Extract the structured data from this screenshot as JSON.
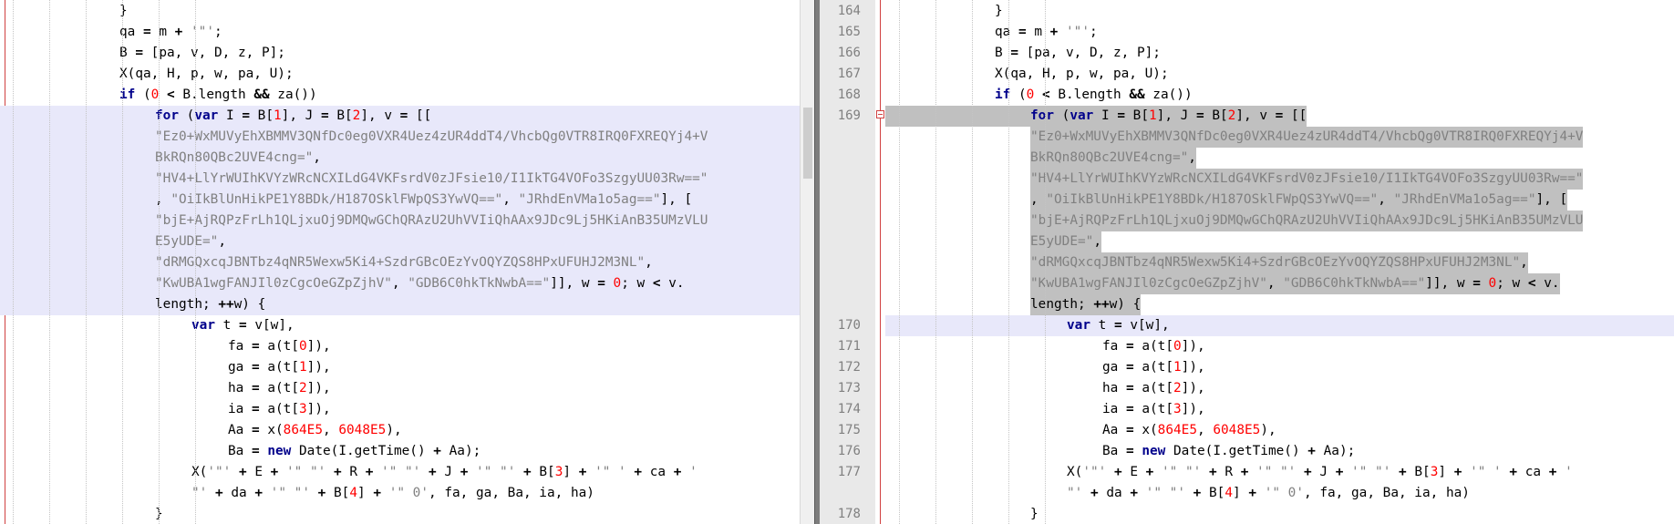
{
  "left": {
    "lines": [
      [
        {
          "t": "}"
        }
      ],
      [
        {
          "t": "qa "
        },
        {
          "t": "=",
          "c": "op"
        },
        {
          "t": " m "
        },
        {
          "t": "+",
          "c": "op"
        },
        {
          "t": " '\"'",
          "c": "str"
        },
        {
          "t": ";"
        }
      ],
      [
        {
          "t": "B "
        },
        {
          "t": "=",
          "c": "op"
        },
        {
          "t": " [pa, v, D, z, P];"
        }
      ],
      [
        {
          "t": "X(qa, H, p, w, pa, U);"
        }
      ],
      [
        {
          "t": "if",
          "c": "kw"
        },
        {
          "t": " ("
        },
        {
          "t": "0",
          "c": "num"
        },
        {
          "t": " "
        },
        {
          "t": "<",
          "c": "op"
        },
        {
          "t": " B.length "
        },
        {
          "t": "&&",
          "c": "op"
        },
        {
          "t": " za())"
        }
      ],
      [
        {
          "t": "for",
          "c": "kw"
        },
        {
          "t": " ("
        },
        {
          "t": "var",
          "c": "kw"
        },
        {
          "t": " I "
        },
        {
          "t": "=",
          "c": "op"
        },
        {
          "t": " B["
        },
        {
          "t": "1",
          "c": "num"
        },
        {
          "t": "], J "
        },
        {
          "t": "=",
          "c": "op"
        },
        {
          "t": " B["
        },
        {
          "t": "2",
          "c": "num"
        },
        {
          "t": "], v "
        },
        {
          "t": "=",
          "c": "op"
        },
        {
          "t": " [["
        }
      ],
      [
        {
          "t": "\"Ez0+WxMUVyEhXBMMV3QNfDc0eg0VXR4Uez4zUR4ddT4/VhcbQg0VTR8IRQ0FXREQYj4+V",
          "c": "str"
        }
      ],
      [
        {
          "t": "BkRQn80QBc2UVE4cng=\"",
          "c": "str"
        },
        {
          "t": ","
        }
      ],
      [
        {
          "t": "\"HV4+LlYrWUIhKVYzWRcNCXILdG4VKFsrdV0zJFsie10/I1IkTG4VOFo3SzgyUU03Rw==\"",
          "c": "str"
        }
      ],
      [
        {
          "t": ", "
        },
        {
          "t": "\"OiIkBlUnHikPE1Y8BDk/H187OSklFWpQS3YwVQ==\"",
          "c": "str"
        },
        {
          "t": ", "
        },
        {
          "t": "\"JRhdEnVMa1o5ag==\"",
          "c": "str"
        },
        {
          "t": "], ["
        }
      ],
      [
        {
          "t": "\"bjE+AjRQPzFrLh1QLjxuOj9DMQwGChQRAzU2UhVVIiQhAAx9JDc9Lj5HKiAnB35UMzVLU",
          "c": "str"
        }
      ],
      [
        {
          "t": "E5yUDE=\"",
          "c": "str"
        },
        {
          "t": ","
        }
      ],
      [
        {
          "t": "\"dRMGQxcqJBNTbz4qNR5Wexw5Ki4+SzdrGBcOEzYvOQYZQS8HPxUFUHJ2M3NL\"",
          "c": "str"
        },
        {
          "t": ","
        }
      ],
      [
        {
          "t": "\"KwUBA1wgFANJIl0zCgcOeGZpZjhV\"",
          "c": "str"
        },
        {
          "t": ", "
        },
        {
          "t": "\"GDB6C0hkTkNwbA==\"",
          "c": "str"
        },
        {
          "t": "]], w "
        },
        {
          "t": "=",
          "c": "op"
        },
        {
          "t": " "
        },
        {
          "t": "0",
          "c": "num"
        },
        {
          "t": "; w "
        },
        {
          "t": "<",
          "c": "op"
        },
        {
          "t": " v."
        }
      ],
      [
        {
          "t": "length; "
        },
        {
          "t": "++",
          "c": "op"
        },
        {
          "t": "w) {"
        }
      ],
      [
        {
          "t": "var",
          "c": "kw"
        },
        {
          "t": " t "
        },
        {
          "t": "=",
          "c": "op"
        },
        {
          "t": " v[w],"
        }
      ],
      [
        {
          "t": "fa "
        },
        {
          "t": "=",
          "c": "op"
        },
        {
          "t": " a(t["
        },
        {
          "t": "0",
          "c": "num"
        },
        {
          "t": "]),"
        }
      ],
      [
        {
          "t": "ga "
        },
        {
          "t": "=",
          "c": "op"
        },
        {
          "t": " a(t["
        },
        {
          "t": "1",
          "c": "num"
        },
        {
          "t": "]),"
        }
      ],
      [
        {
          "t": "ha "
        },
        {
          "t": "=",
          "c": "op"
        },
        {
          "t": " a(t["
        },
        {
          "t": "2",
          "c": "num"
        },
        {
          "t": "]),"
        }
      ],
      [
        {
          "t": "ia "
        },
        {
          "t": "=",
          "c": "op"
        },
        {
          "t": " a(t["
        },
        {
          "t": "3",
          "c": "num"
        },
        {
          "t": "]),"
        }
      ],
      [
        {
          "t": "Aa "
        },
        {
          "t": "=",
          "c": "op"
        },
        {
          "t": " x("
        },
        {
          "t": "864E5",
          "c": "num"
        },
        {
          "t": ", "
        },
        {
          "t": "6048E5",
          "c": "num"
        },
        {
          "t": "),"
        }
      ],
      [
        {
          "t": "Ba "
        },
        {
          "t": "=",
          "c": "op"
        },
        {
          "t": " "
        },
        {
          "t": "new",
          "c": "kw"
        },
        {
          "t": " Date(I.getTime() "
        },
        {
          "t": "+",
          "c": "op"
        },
        {
          "t": " Aa);"
        }
      ],
      [
        {
          "t": "X("
        },
        {
          "t": "'\"'",
          "c": "str"
        },
        {
          "t": " "
        },
        {
          "t": "+",
          "c": "op"
        },
        {
          "t": " E "
        },
        {
          "t": "+",
          "c": "op"
        },
        {
          "t": " "
        },
        {
          "t": "'\" \"'",
          "c": "str"
        },
        {
          "t": " "
        },
        {
          "t": "+",
          "c": "op"
        },
        {
          "t": " R "
        },
        {
          "t": "+",
          "c": "op"
        },
        {
          "t": " "
        },
        {
          "t": "'\" \"'",
          "c": "str"
        },
        {
          "t": " "
        },
        {
          "t": "+",
          "c": "op"
        },
        {
          "t": " J "
        },
        {
          "t": "+",
          "c": "op"
        },
        {
          "t": " "
        },
        {
          "t": "'\" \"'",
          "c": "str"
        },
        {
          "t": " "
        },
        {
          "t": "+",
          "c": "op"
        },
        {
          "t": " B["
        },
        {
          "t": "3",
          "c": "num"
        },
        {
          "t": "] "
        },
        {
          "t": "+",
          "c": "op"
        },
        {
          "t": " "
        },
        {
          "t": "'\" '",
          "c": "str"
        },
        {
          "t": " "
        },
        {
          "t": "+",
          "c": "op"
        },
        {
          "t": " ca "
        },
        {
          "t": "+",
          "c": "op"
        },
        {
          "t": " "
        },
        {
          "t": "'",
          "c": "str"
        }
      ],
      [
        {
          "t": "\"'",
          "c": "str"
        },
        {
          "t": " "
        },
        {
          "t": "+",
          "c": "op"
        },
        {
          "t": " da "
        },
        {
          "t": "+",
          "c": "op"
        },
        {
          "t": " "
        },
        {
          "t": "'\" \"'",
          "c": "str"
        },
        {
          "t": " "
        },
        {
          "t": "+",
          "c": "op"
        },
        {
          "t": " B["
        },
        {
          "t": "4",
          "c": "num"
        },
        {
          "t": "] "
        },
        {
          "t": "+",
          "c": "op"
        },
        {
          "t": " "
        },
        {
          "t": "'\" 0'",
          "c": "str"
        },
        {
          "t": ", fa, ga, Ba, ia, ha)"
        }
      ],
      [
        {
          "t": "}"
        }
      ]
    ]
  },
  "right": {
    "line_numbers": [
      "164",
      "165",
      "166",
      "167",
      "168",
      "169",
      "",
      "",
      "",
      "",
      "",
      "",
      "",
      "",
      "",
      "170",
      "171",
      "172",
      "173",
      "174",
      "175",
      "176",
      "177",
      "",
      "178"
    ],
    "lines": [
      [
        {
          "t": "}"
        }
      ],
      [
        {
          "t": "qa "
        },
        {
          "t": "=",
          "c": "op"
        },
        {
          "t": " m "
        },
        {
          "t": "+",
          "c": "op"
        },
        {
          "t": " '\"'",
          "c": "str"
        },
        {
          "t": ";"
        }
      ],
      [
        {
          "t": "B "
        },
        {
          "t": "=",
          "c": "op"
        },
        {
          "t": " [pa, v, D, z, P];"
        }
      ],
      [
        {
          "t": "X(qa, H, p, w, pa, U);"
        }
      ],
      [
        {
          "t": "if",
          "c": "kw"
        },
        {
          "t": " ("
        },
        {
          "t": "0",
          "c": "num"
        },
        {
          "t": " "
        },
        {
          "t": "<",
          "c": "op"
        },
        {
          "t": " B.length "
        },
        {
          "t": "&&",
          "c": "op"
        },
        {
          "t": " za())"
        }
      ],
      [
        {
          "t": "for",
          "c": "kw"
        },
        {
          "t": " ("
        },
        {
          "t": "var",
          "c": "kw"
        },
        {
          "t": " I "
        },
        {
          "t": "=",
          "c": "op"
        },
        {
          "t": " B["
        },
        {
          "t": "1",
          "c": "num"
        },
        {
          "t": "], J "
        },
        {
          "t": "=",
          "c": "op"
        },
        {
          "t": " B["
        },
        {
          "t": "2",
          "c": "num"
        },
        {
          "t": "], v "
        },
        {
          "t": "=",
          "c": "op"
        },
        {
          "t": " [["
        }
      ],
      [
        {
          "t": "\"Ez0+WxMUVyEhXBMMV3QNfDc0eg0VXR4Uez4zUR4ddT4/VhcbQg0VTR8IRQ0FXREQYj4+V",
          "c": "str"
        }
      ],
      [
        {
          "t": "BkRQn80QBc2UVE4cng=\"",
          "c": "str"
        },
        {
          "t": ","
        }
      ],
      [
        {
          "t": "\"HV4+LlYrWUIhKVYzWRcNCXILdG4VKFsrdV0zJFsie10/I1IkTG4VOFo3SzgyUU03Rw==\"",
          "c": "str"
        }
      ],
      [
        {
          "t": ", "
        },
        {
          "t": "\"OiIkBlUnHikPE1Y8BDk/H187OSklFWpQS3YwVQ==\"",
          "c": "str"
        },
        {
          "t": ", "
        },
        {
          "t": "\"JRhdEnVMa1o5ag==\"",
          "c": "str"
        },
        {
          "t": "], ["
        }
      ],
      [
        {
          "t": "\"bjE+AjRQPzFrLh1QLjxuOj9DMQwGChQRAzU2UhVVIiQhAAx9JDc9Lj5HKiAnB35UMzVLU",
          "c": "str"
        }
      ],
      [
        {
          "t": "E5yUDE=\"",
          "c": "str"
        },
        {
          "t": ","
        }
      ],
      [
        {
          "t": "\"dRMGQxcqJBNTbz4qNR5Wexw5Ki4+SzdrGBcOEzYvOQYZQS8HPxUFUHJ2M3NL\"",
          "c": "str"
        },
        {
          "t": ","
        }
      ],
      [
        {
          "t": "\"KwUBA1wgFANJIl0zCgcOeGZpZjhV\"",
          "c": "str"
        },
        {
          "t": ", "
        },
        {
          "t": "\"GDB6C0hkTkNwbA==\"",
          "c": "str"
        },
        {
          "t": "]], w "
        },
        {
          "t": "=",
          "c": "op"
        },
        {
          "t": " "
        },
        {
          "t": "0",
          "c": "num"
        },
        {
          "t": "; w "
        },
        {
          "t": "<",
          "c": "op"
        },
        {
          "t": " v."
        }
      ],
      [
        {
          "t": "length; "
        },
        {
          "t": "++",
          "c": "op"
        },
        {
          "t": "w) {"
        }
      ],
      [
        {
          "t": "var",
          "c": "kw"
        },
        {
          "t": " t "
        },
        {
          "t": "=",
          "c": "op"
        },
        {
          "t": " v[w],"
        }
      ],
      [
        {
          "t": "fa "
        },
        {
          "t": "=",
          "c": "op"
        },
        {
          "t": " a(t["
        },
        {
          "t": "0",
          "c": "num"
        },
        {
          "t": "]),"
        }
      ],
      [
        {
          "t": "ga "
        },
        {
          "t": "=",
          "c": "op"
        },
        {
          "t": " a(t["
        },
        {
          "t": "1",
          "c": "num"
        },
        {
          "t": "]),"
        }
      ],
      [
        {
          "t": "ha "
        },
        {
          "t": "=",
          "c": "op"
        },
        {
          "t": " a(t["
        },
        {
          "t": "2",
          "c": "num"
        },
        {
          "t": "]),"
        }
      ],
      [
        {
          "t": "ia "
        },
        {
          "t": "=",
          "c": "op"
        },
        {
          "t": " a(t["
        },
        {
          "t": "3",
          "c": "num"
        },
        {
          "t": "]),"
        }
      ],
      [
        {
          "t": "Aa "
        },
        {
          "t": "=",
          "c": "op"
        },
        {
          "t": " x("
        },
        {
          "t": "864E5",
          "c": "num"
        },
        {
          "t": ", "
        },
        {
          "t": "6048E5",
          "c": "num"
        },
        {
          "t": "),"
        }
      ],
      [
        {
          "t": "Ba "
        },
        {
          "t": "=",
          "c": "op"
        },
        {
          "t": " "
        },
        {
          "t": "new",
          "c": "kw"
        },
        {
          "t": " Date(I.getTime() "
        },
        {
          "t": "+",
          "c": "op"
        },
        {
          "t": " Aa);"
        }
      ],
      [
        {
          "t": "X("
        },
        {
          "t": "'\"'",
          "c": "str"
        },
        {
          "t": " "
        },
        {
          "t": "+",
          "c": "op"
        },
        {
          "t": " E "
        },
        {
          "t": "+",
          "c": "op"
        },
        {
          "t": " "
        },
        {
          "t": "'\" \"'",
          "c": "str"
        },
        {
          "t": " "
        },
        {
          "t": "+",
          "c": "op"
        },
        {
          "t": " R "
        },
        {
          "t": "+",
          "c": "op"
        },
        {
          "t": " "
        },
        {
          "t": "'\" \"'",
          "c": "str"
        },
        {
          "t": " "
        },
        {
          "t": "+",
          "c": "op"
        },
        {
          "t": " J "
        },
        {
          "t": "+",
          "c": "op"
        },
        {
          "t": " "
        },
        {
          "t": "'\" \"'",
          "c": "str"
        },
        {
          "t": " "
        },
        {
          "t": "+",
          "c": "op"
        },
        {
          "t": " B["
        },
        {
          "t": "3",
          "c": "num"
        },
        {
          "t": "] "
        },
        {
          "t": "+",
          "c": "op"
        },
        {
          "t": " "
        },
        {
          "t": "'\" '",
          "c": "str"
        },
        {
          "t": " "
        },
        {
          "t": "+",
          "c": "op"
        },
        {
          "t": " ca "
        },
        {
          "t": "+",
          "c": "op"
        },
        {
          "t": " "
        },
        {
          "t": "'",
          "c": "str"
        }
      ],
      [
        {
          "t": "\"'",
          "c": "str"
        },
        {
          "t": " "
        },
        {
          "t": "+",
          "c": "op"
        },
        {
          "t": " da "
        },
        {
          "t": "+",
          "c": "op"
        },
        {
          "t": " "
        },
        {
          "t": "'\" \"'",
          "c": "str"
        },
        {
          "t": " "
        },
        {
          "t": "+",
          "c": "op"
        },
        {
          "t": " B["
        },
        {
          "t": "4",
          "c": "num"
        },
        {
          "t": "] "
        },
        {
          "t": "+",
          "c": "op"
        },
        {
          "t": " "
        },
        {
          "t": "'\" 0'",
          "c": "str"
        },
        {
          "t": ", fa, ga, Ba, ia, ha)"
        }
      ],
      [
        {
          "t": "}"
        }
      ]
    ]
  },
  "icons": {
    "fold_marker": "fold-collapse-icon",
    "change_bar": "diff-change-bar"
  },
  "colors": {
    "keyword": "#00008b",
    "string": "#808080",
    "number": "#ff0000",
    "changed_block_left": "#e8e8fa",
    "changed_block_right_selection": "#c0c0c0",
    "gutter": "#e9e9e9"
  }
}
